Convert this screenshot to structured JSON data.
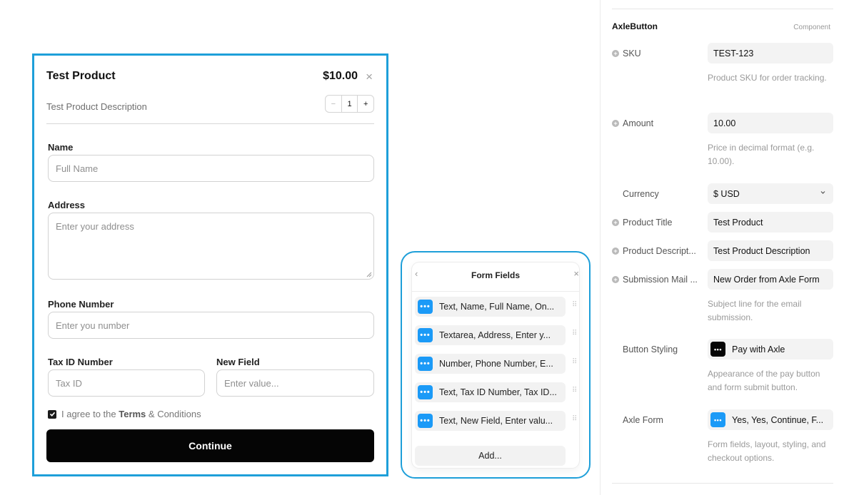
{
  "product": {
    "title": "Test Product",
    "price": "$10.00",
    "close_icon": "×",
    "description": "Test Product Description",
    "stepper": {
      "minus": "−",
      "quantity": "1",
      "plus": "+"
    }
  },
  "form": {
    "name_label": "Name",
    "name_placeholder": "Full Name",
    "address_label": "Address",
    "address_placeholder": "Enter your address",
    "phone_label": "Phone Number",
    "phone_placeholder": "Enter you number",
    "tax_label": "Tax ID Number",
    "tax_placeholder": "Tax ID",
    "new_field_label": "New Field",
    "new_field_placeholder": "Enter value...",
    "terms_prefix": "I agree to the ",
    "terms_bold": "Terms",
    "terms_suffix": " & Conditions",
    "terms_checked": true,
    "continue_label": "Continue"
  },
  "form_fields_panel": {
    "back_icon": "‹",
    "title": "Form Fields",
    "close_icon": "×",
    "items": [
      {
        "label": "Text, Name, Full Name, On..."
      },
      {
        "label": "Textarea, Address, Enter y..."
      },
      {
        "label": "Number, Phone Number, E..."
      },
      {
        "label": "Text, Tax ID Number, Tax ID..."
      },
      {
        "label": "Text, New Field, Enter valu..."
      }
    ],
    "add_label": "Add..."
  },
  "properties": {
    "component_name": "AxleButton",
    "component_kind": "Component",
    "sku": {
      "label": "SKU",
      "value": "TEST-123",
      "help": "Product SKU for order tracking."
    },
    "amount": {
      "label": "Amount",
      "value": "10.00",
      "help": "Price in decimal format (e.g. 10.00)."
    },
    "currency": {
      "label": "Currency",
      "value": "$ USD"
    },
    "product_title": {
      "label": "Product Title",
      "value": "Test Product"
    },
    "product_description": {
      "label": "Product Descript...",
      "value": "Test Product Description"
    },
    "submission_mail": {
      "label": "Submission Mail ...",
      "value": "New Order from Axle Form",
      "help": "Subject line for the email submission."
    },
    "button_styling": {
      "label": "Button Styling",
      "value": "Pay with Axle",
      "help": "Appearance of the pay button and form submit button."
    },
    "axle_form": {
      "label": "Axle Form",
      "value": "Yes, Yes, Continue, F...",
      "help": "Form fields, layout, styling, and checkout options."
    }
  },
  "colors": {
    "selection_blue": "#1e9fd9",
    "icon_blue": "#1b9af7",
    "button_black": "#050505"
  }
}
